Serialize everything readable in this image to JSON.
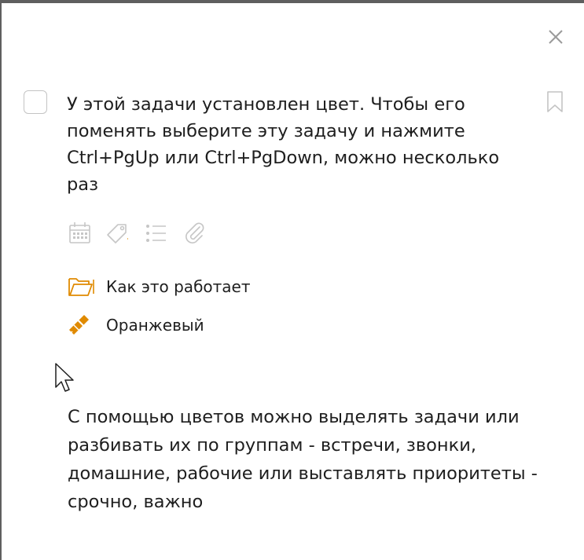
{
  "task": {
    "title": "У этой задачи установлен цвет. Чтобы его поменять выберите эту задачу и нажмите Ctrl+PgUp или Ctrl+PgDown, можно несколько раз",
    "project_label": "Как это работает",
    "color_label": "Оранжевый",
    "note": "С помощью цветов можно выделять задачи или разбивать их по группам - встречи, звонки, домашние, рабочие или выставлять приоритеты - срочно, важно"
  },
  "toolbar": {
    "icons": [
      "calendar-icon",
      "tag-icon",
      "checklist-icon",
      "paperclip-icon"
    ]
  },
  "colors": {
    "accent": "#e08a00",
    "icon_gray": "#c6c6c6",
    "text": "#1e1e1e",
    "frame": "#5f5f5f"
  }
}
